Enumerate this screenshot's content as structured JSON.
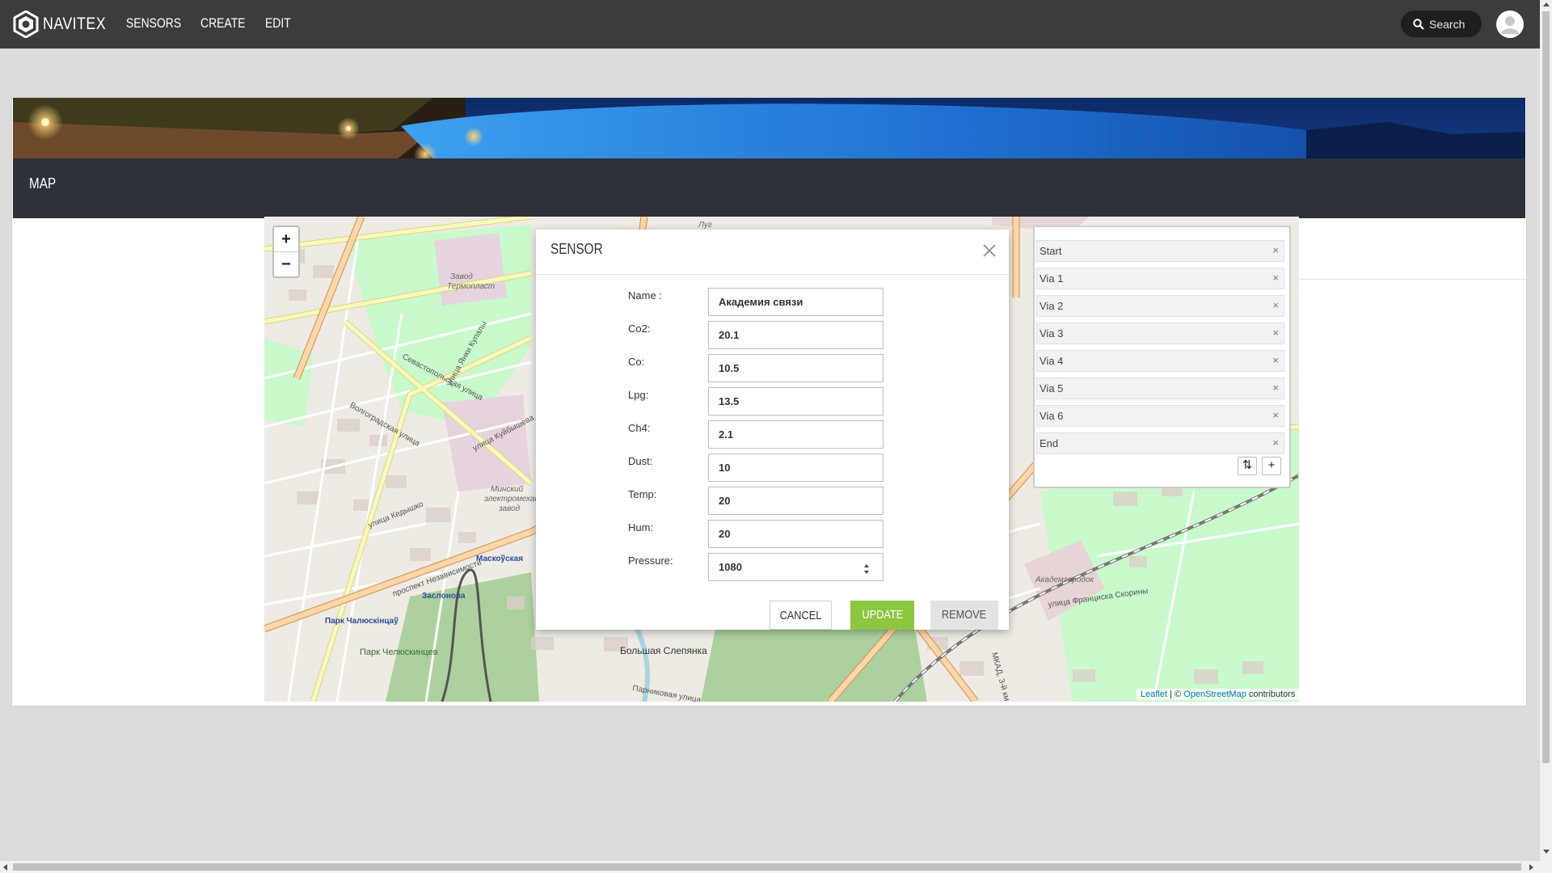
{
  "app": {
    "brand": "NAVITEX"
  },
  "nav": {
    "items": [
      "SENSORS",
      "CREATE",
      "EDIT"
    ],
    "search_label": "Search"
  },
  "page": {
    "section_title": "MAP"
  },
  "map": {
    "zoom_in": "+",
    "zoom_out": "−",
    "attribution": {
      "leaflet": "Leaflet",
      "sep": " | © ",
      "osm": "OpenStreetMap",
      "suffix": " contributors"
    },
    "labels": {
      "zavod_termoplast_1": "Завод",
      "zavod_termoplast_2": "Термопласт",
      "sevastopolskaya": "Севастопольская улица",
      "volgogradskaya": "Волгоградская улица",
      "kedyshko": "улица Кедышко",
      "minsk_electro_1": "Минский",
      "minsk_electro_2": "электромеханический",
      "minsk_electro_3": "завод",
      "maskouskaya": "Маскоўская",
      "zaslonova": "Заслонова",
      "park_chalyuskintsau": "Парк Чалюскінцаў",
      "park_chelyuskintsev": "Парк Челюскинцев",
      "nezavisimosti": "проспект Независимости",
      "bolshaya_slepyanka": "Большая Слепянка",
      "parkovaya": "Парниковая улица",
      "akademgorodok": "Академгородок",
      "skoriny": "улица Франциска Скорины",
      "mkad": "МКАД, 3-й км",
      "lug": "Луг",
      "yanki_kupaly": "улица Янки Купалы",
      "kuibysheva": "улица Куйбышева"
    }
  },
  "routing": {
    "waypoints": [
      "Start",
      "Via 1",
      "Via 2",
      "Via 3",
      "Via 4",
      "Via 5",
      "Via 6",
      "End"
    ],
    "remove_glyph": "×",
    "reverse_glyph": "⇅",
    "add_glyph": "+"
  },
  "modal": {
    "title": "SENSOR",
    "fields": [
      {
        "label": "Name :",
        "value": "Академия связи"
      },
      {
        "label": "Co2:",
        "value": "20.1"
      },
      {
        "label": "Co:",
        "value": "10.5"
      },
      {
        "label": "Lpg:",
        "value": "13.5"
      },
      {
        "label": "Ch4:",
        "value": "2.1"
      },
      {
        "label": "Dust:",
        "value": "10"
      },
      {
        "label": "Temp:",
        "value": "20"
      },
      {
        "label": "Hum:",
        "value": "20"
      },
      {
        "label": "Pressure:",
        "value": "1080"
      }
    ],
    "buttons": {
      "cancel": "CANCEL",
      "update": "UPDATE",
      "remove": "REMOVE"
    }
  },
  "colors": {
    "navbar": "#3c3c3c",
    "accent_green": "#8dc63f",
    "map_park": "#c8facc",
    "map_road_major": "#f7a86a",
    "map_road_secondary": "#f7fabf"
  }
}
